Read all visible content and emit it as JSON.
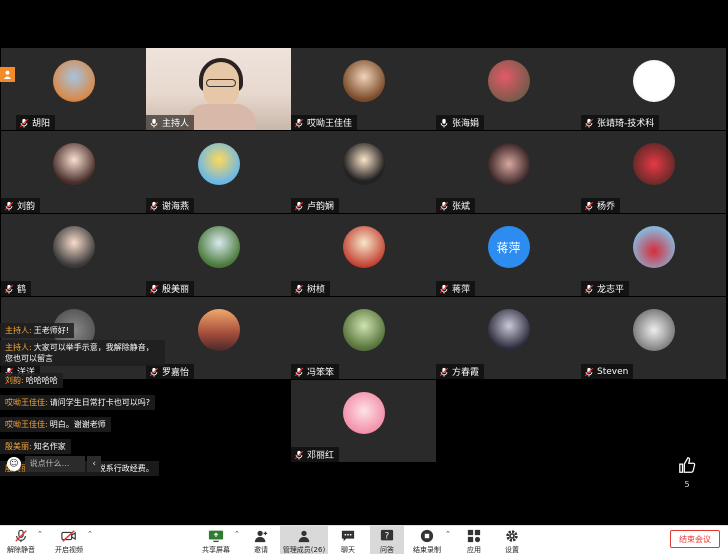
{
  "participants": [
    {
      "name": "胡阳",
      "avatar": "photo-outdoor-icon",
      "muted": true,
      "host_badge": true
    },
    {
      "name": "主持人",
      "avatar": "camera-video",
      "muted": false,
      "active": true
    },
    {
      "name": "哎呦王佳佳",
      "avatar": "girl-portrait-icon",
      "muted": true
    },
    {
      "name": "张海娟",
      "avatar": "flowers-photo-icon",
      "muted": false
    },
    {
      "name": "张靖琦-技术科",
      "avatar": "cartoon-animal-icon",
      "muted": true
    },
    {
      "name": "刘韵",
      "avatar": "cartoon-girl-icon",
      "muted": true
    },
    {
      "name": "谢海燕",
      "avatar": "cartoon-landscape-icon",
      "muted": true
    },
    {
      "name": "卢韵娴",
      "avatar": "cartoon-girl-bow-icon",
      "muted": true
    },
    {
      "name": "张斌",
      "avatar": "hand-photo-icon",
      "muted": true
    },
    {
      "name": "杨乔",
      "avatar": "flowers-red-icon",
      "muted": true
    },
    {
      "name": "鹤",
      "avatar": "cartoon-boy-icon",
      "muted": true
    },
    {
      "name": "殷美丽",
      "avatar": "tree-photo-icon",
      "muted": true
    },
    {
      "name": "树桢",
      "avatar": "cartoon-reader-icon",
      "muted": true
    },
    {
      "name": "蒋萍",
      "avatar": "text-avatar",
      "avatar_text": "蒋萍",
      "avatar_color": "#2d8cf0",
      "muted": true
    },
    {
      "name": "龙志平",
      "avatar": "red-flowers-icon",
      "muted": true
    },
    {
      "name": "洋洋",
      "avatar": "photo-icon",
      "muted": true
    },
    {
      "name": "罗嘉怡",
      "avatar": "sunset-photo-icon",
      "muted": true
    },
    {
      "name": "冯笨笨",
      "avatar": "plant-photo-icon",
      "muted": true
    },
    {
      "name": "方春霞",
      "avatar": "window-photo-icon",
      "muted": true
    },
    {
      "name": "Steven",
      "avatar": "sketch-photo-icon",
      "muted": true
    },
    {
      "name": "邓丽红",
      "avatar": "cartoon-girl-pink-icon",
      "muted": true
    }
  ],
  "chat": {
    "messages": [
      {
        "sender": "主持人:",
        "text": "王老师好!"
      },
      {
        "sender": "主持人:",
        "text": "大家可以举手示意，我解除静音，您也可以留言"
      },
      {
        "sender": "刘韵:",
        "text": "哈哈哈哈"
      },
      {
        "sender": "哎呦王佳佳:",
        "text": "请问学生日常打卡也可以吗?"
      },
      {
        "sender": "哎呦王佳佳:",
        "text": "明白。谢谢老师"
      },
      {
        "sender": "殷美丽:",
        "text": "知名作家"
      },
      {
        "sender": "殷美丽:",
        "text": "不是科研项目，用脱系行政经费。"
      }
    ],
    "input_placeholder": "说点什么...",
    "collapse_glyph": "‹",
    "emoji_glyph": "☺"
  },
  "like": {
    "count": "5"
  },
  "toolbar": {
    "unmute": "解除静音",
    "start_video": "开启视频",
    "share_screen": "共享屏幕",
    "invite": "邀请",
    "manage_participants": "管理成员(26)",
    "chat": "聊天",
    "qa": "问答",
    "end_recording": "结束录制",
    "apps": "应用",
    "settings": "设置",
    "end_meeting": "结束会议"
  },
  "colors": {
    "accent_orange": "#f28c28",
    "end_red": "#e53935",
    "active_green": "#2ecc40",
    "sender_orange": "#f4a640"
  }
}
